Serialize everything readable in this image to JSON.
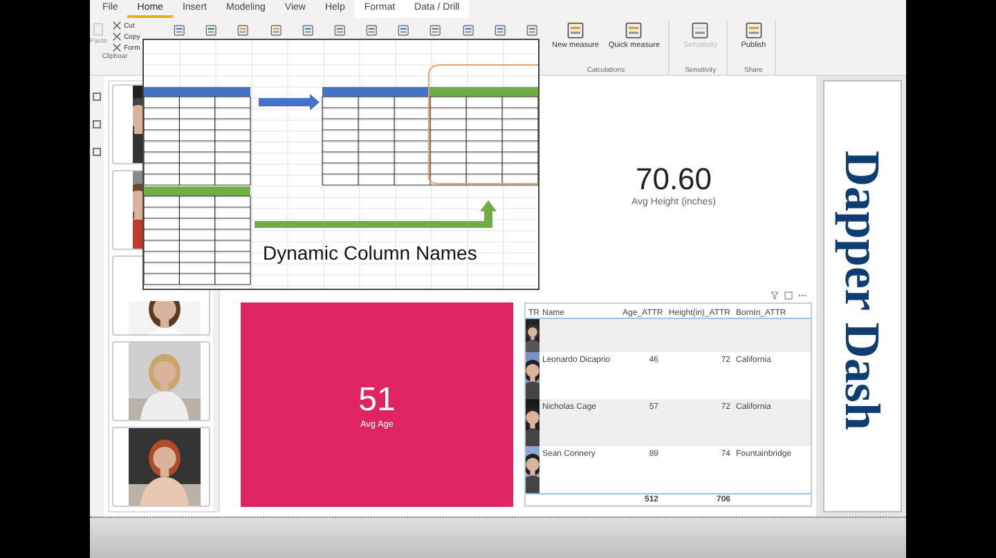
{
  "ribbon": {
    "tabs": [
      {
        "label": "File",
        "selected": false,
        "kind": "standard"
      },
      {
        "label": "Home",
        "selected": true,
        "kind": "standard"
      },
      {
        "label": "Insert",
        "selected": false,
        "kind": "standard"
      },
      {
        "label": "Modeling",
        "selected": false,
        "kind": "standard"
      },
      {
        "label": "View",
        "selected": false,
        "kind": "standard"
      },
      {
        "label": "Help",
        "selected": false,
        "kind": "standard"
      },
      {
        "label": "Format",
        "selected": false,
        "kind": "contextual"
      },
      {
        "label": "Data / Drill",
        "selected": false,
        "kind": "contextual"
      }
    ],
    "clipboard": {
      "paste": "Paste",
      "items": [
        "Cut",
        "Copy",
        "Form"
      ],
      "group": "Clipboar"
    },
    "groups": [
      {
        "name": "Calculations",
        "buttons": [
          {
            "label": "New measure",
            "disabled": false
          },
          {
            "label": "Quick measure",
            "disabled": false
          }
        ]
      },
      {
        "name": "Sensitivity",
        "buttons": [
          {
            "label": "Sensitivity",
            "disabled": true
          }
        ]
      },
      {
        "name": "Share",
        "buttons": [
          {
            "label": "Publish",
            "disabled": false
          }
        ]
      }
    ]
  },
  "inset": {
    "caption": "Dynamic Column Names"
  },
  "height_card": {
    "value": "70.60",
    "label": "Avg Height (inches)"
  },
  "age_card": {
    "value": "51",
    "label": "Avg Age"
  },
  "table": {
    "columns": [
      "TR",
      "Name",
      "Age_ATTR",
      "Height(in)_ATTR",
      "BornIn_ATTR"
    ],
    "rows": [
      [
        "",
        "Leonardo Dicaprio",
        "46",
        "72",
        "California"
      ],
      [
        "",
        "Nicholas Cage",
        "57",
        "72",
        "California"
      ],
      [
        "",
        "Sean Connery",
        "89",
        "74",
        "Fountainbridge"
      ]
    ],
    "totals": [
      "512",
      "706"
    ]
  },
  "title": "Dapper Dash"
}
